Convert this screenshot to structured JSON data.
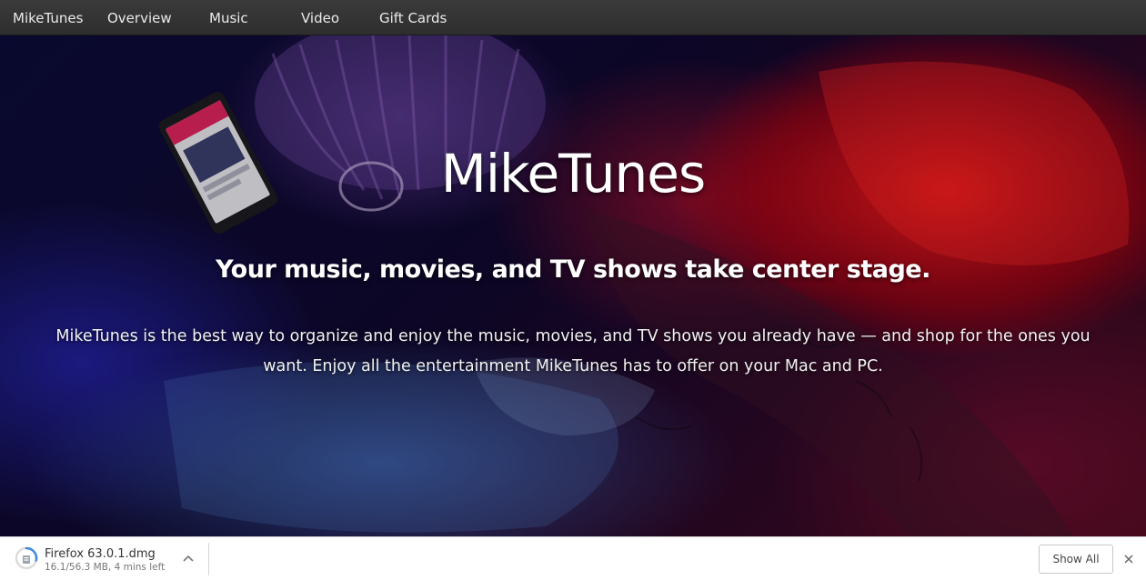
{
  "nav": {
    "brand": "MikeTunes",
    "links": [
      "Overview",
      "Music",
      "Video",
      "Gift Cards"
    ]
  },
  "hero": {
    "title": "MikeTunes",
    "subtitle": "Your music, movies, and TV shows take center stage.",
    "body": "MikeTunes is the best way to organize and enjoy the music, movies, and TV shows you already have — and shop for the ones you want. Enjoy all the entertainment MikeTunes has to offer on your Mac and PC."
  },
  "download_bar": {
    "file_name": "Firefox 63.0.1.dmg",
    "status": "16.1/56.3 MB, 4 mins left",
    "progress": 0.286,
    "show_all_label": "Show All"
  },
  "icons": {
    "download": "download-progress-icon",
    "menu": "chevron-up-icon",
    "close": "close-icon"
  },
  "colors": {
    "nav_bg": "#333333",
    "progress": "#3d8ae0"
  }
}
